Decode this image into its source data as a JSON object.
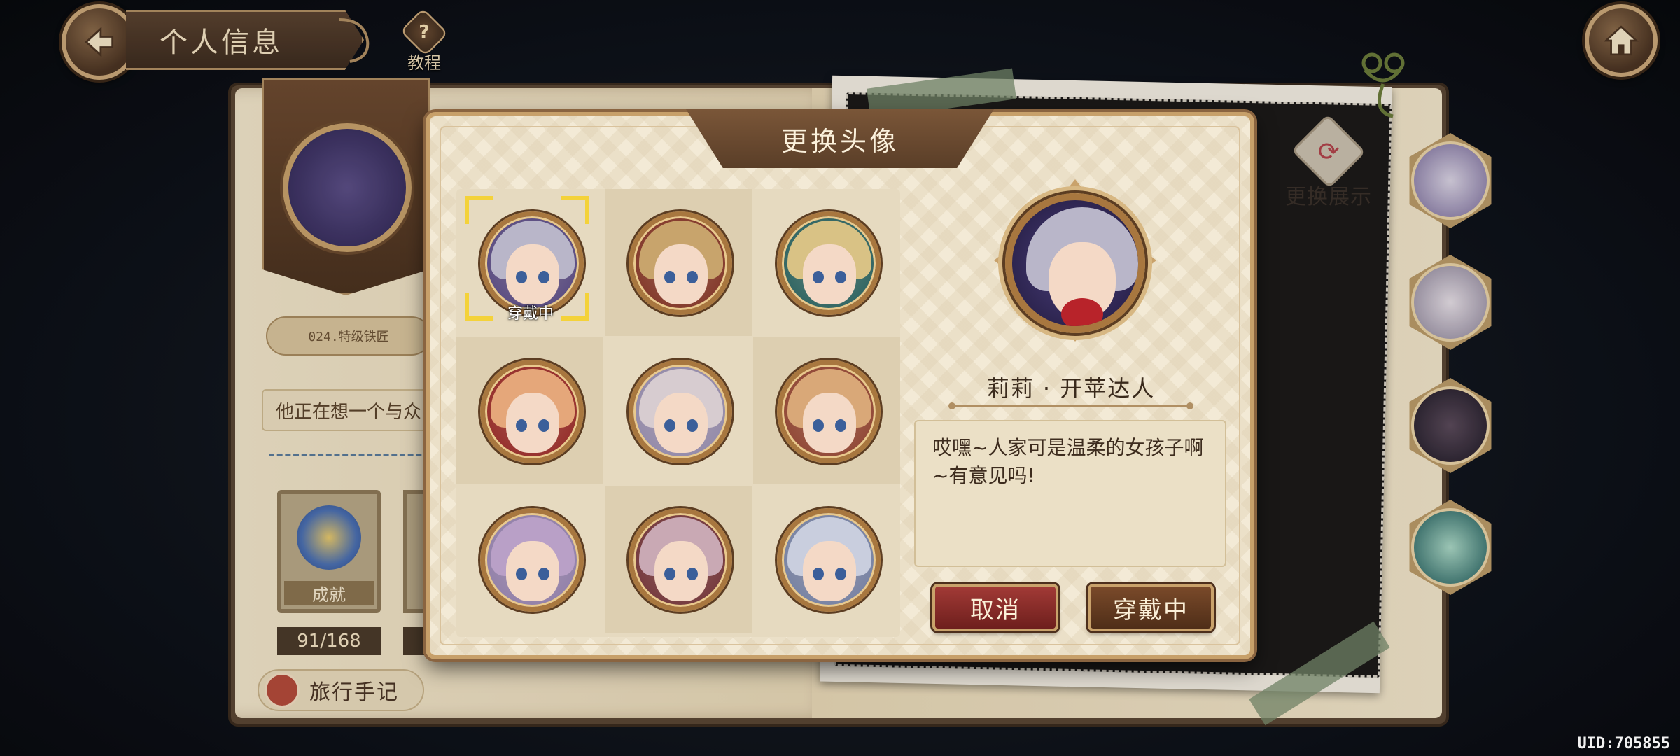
{
  "header": {
    "title": "个人信息",
    "tutorial_label": "教程"
  },
  "profile": {
    "level_title": "024.特级铁匠",
    "signature": "他正在想一个与众",
    "achievement_label": "成就",
    "achievement_count": "91/168",
    "journal_label": "旅行手记"
  },
  "showcase": {
    "swap_label": "更换展示",
    "swap_icon": "swap-arrows-icon"
  },
  "modal": {
    "title": "更换头像",
    "avatars": [
      {
        "id": "lily-apple",
        "hair": "#b9b6c9",
        "bg": "#4d3f7c",
        "wearing": true
      },
      {
        "id": "red-hat-girl",
        "hair": "#c8a46c",
        "bg": "#7b2b1f",
        "wearing": false
      },
      {
        "id": "teal-hood",
        "hair": "#d9c285",
        "bg": "#1f5a5a",
        "wearing": false
      },
      {
        "id": "red-hood",
        "hair": "#e5a77a",
        "bg": "#8f1f1f",
        "wearing": false
      },
      {
        "id": "maid-white",
        "hair": "#d7ccd0",
        "bg": "#8c83a8",
        "wearing": false
      },
      {
        "id": "blonde-red-bow",
        "hair": "#d9a878",
        "bg": "#8a3b2b",
        "wearing": false
      },
      {
        "id": "purple-crown",
        "hair": "#b9a0c7",
        "bg": "#8a78a8",
        "wearing": false
      },
      {
        "id": "dark-ribbon",
        "hair": "#c9a9b4",
        "bg": "#6b2b33",
        "wearing": false
      },
      {
        "id": "silver-hair",
        "hair": "#c9cede",
        "bg": "#6d7aa1",
        "wearing": false
      }
    ],
    "wearing_tag": "穿戴中",
    "selected_name": "莉莉 · 开苹达人",
    "selected_quote": "哎嘿~人家可是温柔的女孩子啊~有意见吗!",
    "cancel_label": "取消",
    "wear_label": "穿戴中"
  },
  "footer": {
    "uid": "UID:705855"
  },
  "colors": {
    "gold": "#c9a26b",
    "cancel_red": "#a23a36",
    "wear_brown": "#7a4a2a",
    "selected_yellow": "#f4d23a"
  }
}
